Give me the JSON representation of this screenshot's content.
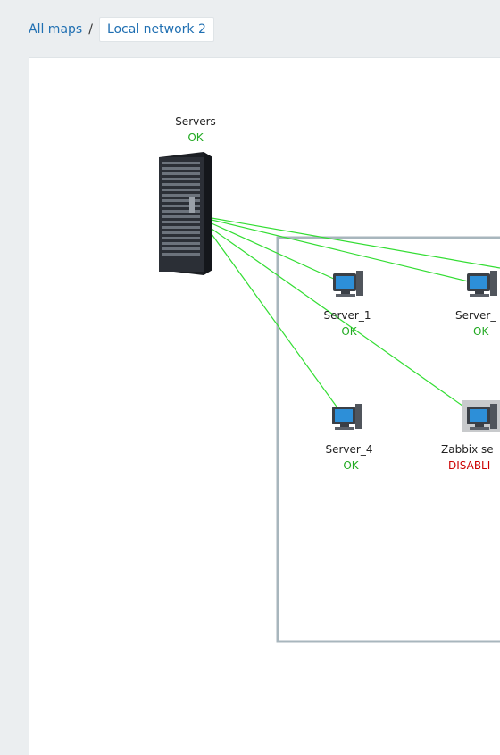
{
  "breadcrumb": {
    "all_maps": "All maps",
    "separator": "/",
    "current": "Local network 2"
  },
  "colors": {
    "ok": "#22aa22",
    "disabled": "#cc0000",
    "link_line": "#33dd33",
    "group_border": "#a8b6bd",
    "breadcrumb_link": "#1f6fb2"
  },
  "map": {
    "elements": [
      {
        "name": "Servers",
        "status": "OK",
        "icon": "server-rack-icon"
      },
      {
        "name": "Server_1",
        "status": "OK",
        "icon": "workstation-icon"
      },
      {
        "name": "Server_",
        "status": "OK",
        "icon": "workstation-icon"
      },
      {
        "name": "Server_4",
        "status": "OK",
        "icon": "workstation-icon"
      },
      {
        "name": "Zabbix se",
        "status": "DISABLI",
        "icon": "workstation-disabled-icon"
      }
    ]
  }
}
